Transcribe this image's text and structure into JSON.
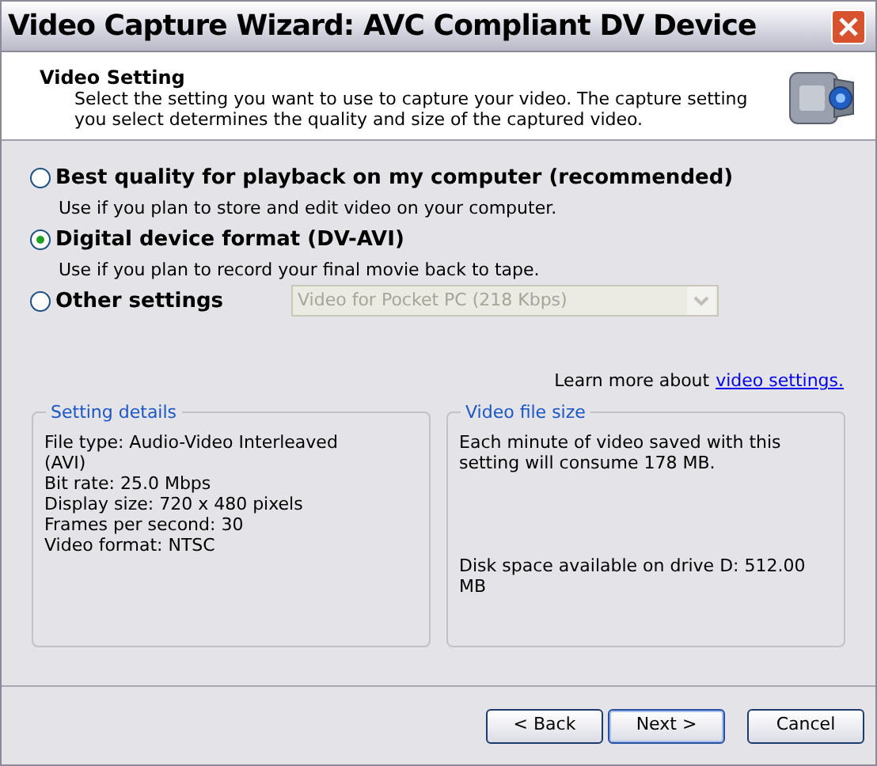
{
  "window": {
    "title": "Video Capture Wizard: AVC Compliant DV Device"
  },
  "header": {
    "title": "Video Setting",
    "description": "Select the setting you want to use to capture your video. The capture setting you select determines the quality and size of the captured video."
  },
  "options": [
    {
      "label": "Best quality for playback on my computer (recommended)",
      "description": "Use if you plan to store and edit video on your computer.",
      "selected": false
    },
    {
      "label": "Digital device format (DV-AVI)",
      "description": "Use if you plan to record your final movie back to tape.",
      "selected": true
    },
    {
      "label": "Other settings",
      "dropdown": {
        "value": "Video for Pocket PC (218 Kbps)",
        "disabled": true
      },
      "selected": false
    }
  ],
  "learn_more": {
    "text": "Learn more about",
    "link": "video settings."
  },
  "setting_details": {
    "title": "Setting details",
    "lines": [
      "File type: Audio-Video Interleaved (AVI)",
      "Bit rate: 25.0 Mbps",
      "Display size: 720 x 480 pixels",
      "Frames per second: 30",
      "Video format: NTSC"
    ]
  },
  "video_file_size": {
    "title": "Video file size",
    "estimate": "Each minute of video saved with this setting will consume 178 MB.",
    "disk_space": "Disk space available on drive D: 512.00 MB"
  },
  "buttons": [
    {
      "label": "< Back",
      "default": false
    },
    {
      "label": "Next >",
      "default": true
    },
    {
      "label": "Cancel",
      "default": false
    }
  ]
}
